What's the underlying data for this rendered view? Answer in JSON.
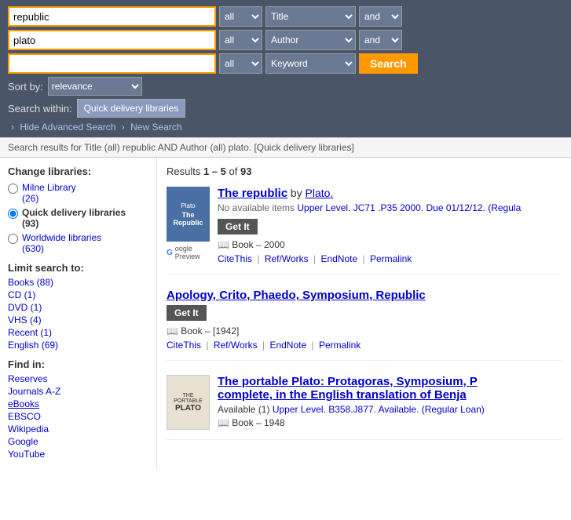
{
  "search": {
    "rows": [
      {
        "text_value": "republic",
        "scope": "all",
        "field": "Title",
        "bool": "and"
      },
      {
        "text_value": "plato",
        "scope": "all",
        "field": "Author",
        "bool": "and"
      },
      {
        "text_value": "",
        "scope": "all",
        "field": "Keyword",
        "bool": ""
      }
    ],
    "search_btn_label": "Search",
    "sort_label": "Sort by:",
    "sort_value": "relevance",
    "within_label": "Search within:",
    "within_value": "Quick delivery libraries",
    "hide_adv_label": "Hide Advanced Search",
    "new_search_label": "New Search"
  },
  "results_bar": {
    "text": "Search results for Title (all) republic AND Author (all) plato. [Quick delivery libraries]"
  },
  "sidebar": {
    "change_libraries_heading": "Change libraries:",
    "libraries": [
      {
        "name": "Milne Library",
        "count": "(26)",
        "active": false
      },
      {
        "name": "Quick delivery libraries",
        "count": "(93)",
        "active": true
      },
      {
        "name": "Worldwide libraries",
        "count": "(630)",
        "active": false
      }
    ],
    "limit_heading": "Limit search to:",
    "limit_items": [
      "Books (88)",
      "CD (1)",
      "DVD (1)",
      "VHS (4)",
      "Recent (1)",
      "English (69)"
    ],
    "find_in_heading": "Find in:",
    "find_in_items": [
      "Reserves",
      "Journals A-Z",
      "eBooks",
      "EBSCO",
      "Wikipedia",
      "Google",
      "YouTube"
    ]
  },
  "results": {
    "count_text": "Results",
    "range_start": "1",
    "range_end": "5",
    "total": "93",
    "items": [
      {
        "id": 1,
        "title": "The republic",
        "author_prefix": "by",
        "author": "Plato.",
        "no_items_text": "No available items",
        "location": "Upper Level. JC71 .P35 2000. Due 01/12/12. (Regula",
        "get_it_label": "Get It",
        "type": "Book",
        "year": "2000",
        "has_cover": true,
        "cover_author": "Plato",
        "cover_title": "The Republic",
        "has_google_preview": true,
        "actions": [
          "CiteThis",
          "Ref/Works",
          "EndNote",
          "Permalink"
        ]
      },
      {
        "id": 2,
        "title": "Apology, Crito, Phaedo, Symposium, Republic",
        "author_prefix": "",
        "author": "",
        "no_items_text": "",
        "location": "",
        "get_it_label": "Get It",
        "type": "Book",
        "year": "[1942]",
        "has_cover": false,
        "actions": [
          "CiteThis",
          "Ref/Works",
          "EndNote",
          "Permalink"
        ]
      },
      {
        "id": 3,
        "title": "The portable Plato: Protagoras, Symposium, P",
        "title_cont": "complete, in the English translation of Benja",
        "author_prefix": "",
        "author": "",
        "available_text": "Available (1)",
        "location": "Upper Level. B358.J877. Available. (Regular Loan)",
        "get_it_label": "",
        "type": "Book",
        "year": "1948",
        "has_cover": true,
        "cover_style": "portable",
        "actions": []
      }
    ]
  }
}
